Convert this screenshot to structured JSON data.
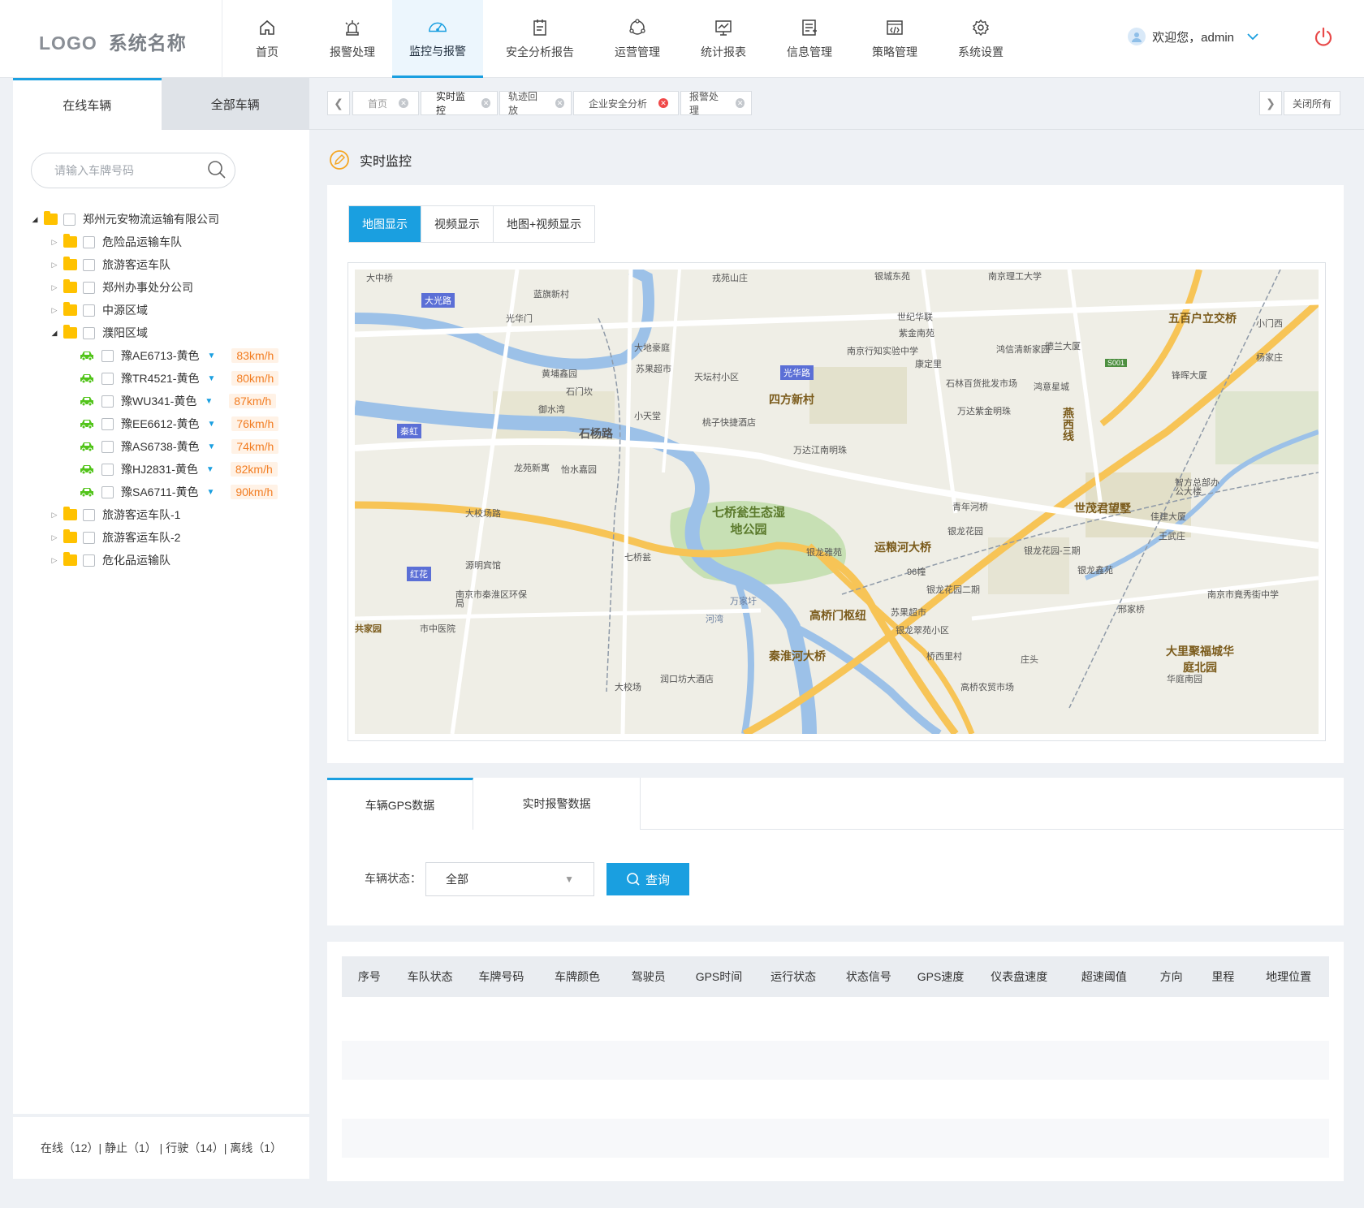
{
  "brand": {
    "logo": "LOGO",
    "system_name": "系统名称"
  },
  "nav": [
    {
      "label": "首页",
      "icon": "home-icon"
    },
    {
      "label": "报警处理",
      "icon": "alarm-icon"
    },
    {
      "label": "监控与报警",
      "icon": "dashboard-icon",
      "active": true
    },
    {
      "label": "安全分析报告",
      "icon": "report-icon"
    },
    {
      "label": "运营管理",
      "icon": "cycle-icon"
    },
    {
      "label": "统计报表",
      "icon": "chart-icon"
    },
    {
      "label": "信息管理",
      "icon": "info-icon"
    },
    {
      "label": "策略管理",
      "icon": "strategy-icon"
    },
    {
      "label": "系统设置",
      "icon": "gear-icon"
    }
  ],
  "user": {
    "greeting": "欢迎您，admin"
  },
  "left": {
    "tabs": [
      "在线车辆",
      "全部车辆"
    ],
    "search_placeholder": "请输入车牌号码",
    "tree": {
      "root": "郑州元安物流运输有限公司",
      "groups_top": [
        "危险品运输车队",
        "旅游客运车队",
        "郑州办事处分公司",
        "中源区域"
      ],
      "open_group": "濮阳区域",
      "vehicles": [
        {
          "plate": "豫AE6713-黄色",
          "speed": "83km/h"
        },
        {
          "plate": "豫TR4521-黄色",
          "speed": "80km/h"
        },
        {
          "plate": "豫WU341-黄色",
          "speed": "87km/h"
        },
        {
          "plate": "豫EE6612-黄色",
          "speed": "76km/h"
        },
        {
          "plate": "豫AS6738-黄色",
          "speed": "74km/h"
        },
        {
          "plate": "豫HJ2831-黄色",
          "speed": "82km/h"
        },
        {
          "plate": "豫SA6711-黄色",
          "speed": "90km/h"
        }
      ],
      "groups_bottom": [
        "旅游客运车队-1",
        "旅游客运车队-2",
        "危化品运输队"
      ]
    },
    "footer": "在线（12）|  静止（1）  |  行驶（14）| 离线（1）"
  },
  "page_tabs": [
    {
      "label": "首页"
    },
    {
      "label": "实时监控"
    },
    {
      "label": "轨迹回放"
    },
    {
      "label": "企业安全分析"
    },
    {
      "label": "报警处理"
    }
  ],
  "close_all": "关闭所有",
  "section_title": "实时监控",
  "view_tabs": [
    "地图显示",
    "视频显示",
    "地图+视频显示"
  ],
  "map_labels": {
    "places": [
      "大中桥",
      "光华门",
      "戎苑山庄",
      "银城东苑",
      "南京理工大学",
      "五百户立交桥",
      "小门西",
      "大光路",
      "蓝旗新村",
      "大地豪庭",
      "苏果超市",
      "天坛村小区",
      "光华路",
      "四方新村",
      "世纪华联",
      "紫金南苑",
      "南京行知实验中学",
      "康定里",
      "鸿信清新家园",
      "德兰大厦",
      "锋晖大厦",
      "杨家庄",
      "黄埔鑫园",
      "石门坎",
      "御水湾",
      "小天堂",
      "桃子快捷酒店",
      "万达紫金明珠",
      "万达江南明珠",
      "石林百货批发市场",
      "鸿意星城",
      "秦虹",
      "石杨路",
      "七桥瓮生态湿地公园",
      "大校场路",
      "龙苑新寓",
      "怡水嘉园",
      "七桥瓮",
      "源明宾馆",
      "红花",
      "南京市秦淮区环保局",
      "市中医院",
      "共家园",
      "万家圩",
      "河湾",
      "高桥门枢纽",
      "秦淮河大桥",
      "运粮河大桥",
      "银龙雅苑",
      "96幢",
      "银龙花园二期",
      "苏果超市",
      "银龙翠苑小区",
      "桥西里村",
      "庄头",
      "高桥农贸市场",
      "大校场",
      "润口坊大酒店",
      "青年河桥",
      "银龙花园",
      "银龙花园-三期",
      "银龙鑫苑",
      "世茂君望墅",
      "智方总部办公大楼",
      "佳建大厦",
      "王武庄",
      "邢家桥",
      "南京市竟秀街中学",
      "大里聚福城华庭北园",
      "华庭南园",
      "燕西线",
      "S001"
    ]
  },
  "data_tabs": [
    "车辆GPS数据",
    "实时报警数据"
  ],
  "filter": {
    "label": "车辆状态：",
    "value": "全部",
    "query": "查询"
  },
  "table": {
    "headers": [
      "序号",
      "车队状态",
      "车牌号码",
      "车牌颜色",
      "驾驶员",
      "GPS时间",
      "运行状态",
      "状态信号",
      "GPS速度",
      "仪表盘速度",
      "超速阈值",
      "方向",
      "里程",
      "地理位置"
    ]
  },
  "colors": {
    "accent": "#1a9fe0",
    "speed": "#f27d22",
    "folder": "#ffc200",
    "car": "#52c41a"
  }
}
